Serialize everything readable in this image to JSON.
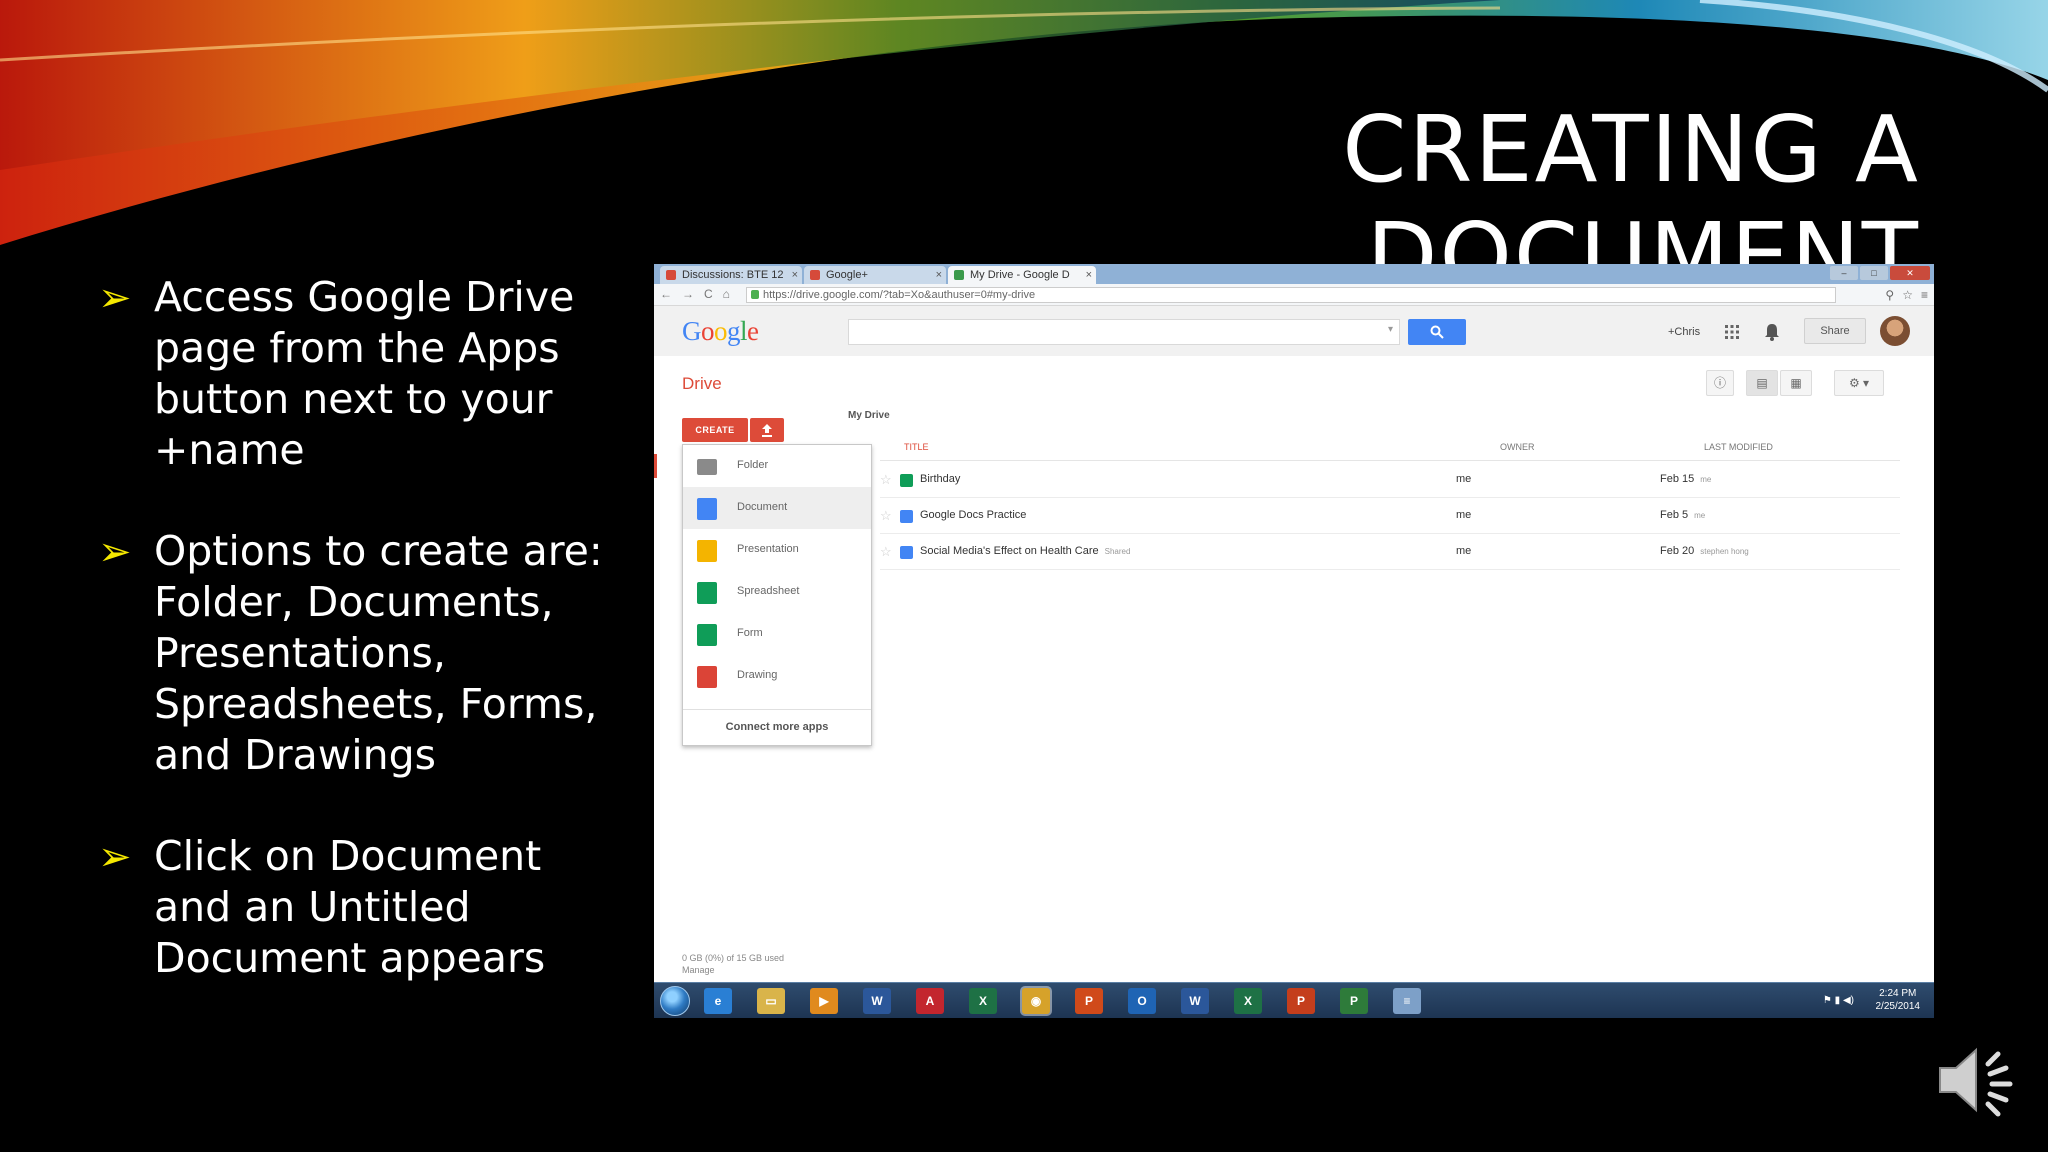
{
  "slide": {
    "title": "CREATING A DOCUMENT",
    "bullets": [
      "Access Google Drive\npage from the Apps\nbutton next to your\n+name",
      "Options to create are:\nFolder, Documents,\nPresentations,\nSpreadsheets, Forms,\nand Drawings",
      "Click on Document\nand an Untitled\nDocument appears"
    ],
    "bullet_symbol": "➢",
    "bullet_color": "#f5e800"
  },
  "browser": {
    "tabs": [
      {
        "label": "Discussions: BTE 12",
        "icon_color": "#d64a3a"
      },
      {
        "label": "Google+",
        "icon_color": "#d64a3a"
      },
      {
        "label": "My Drive - Google D",
        "icon_color": "#3a9a4b"
      }
    ],
    "url": "https://drive.google.com/?tab=Xo&authuser=0#my-drive",
    "window_buttons": [
      "–",
      "□",
      "✕"
    ]
  },
  "google": {
    "logo": [
      "G",
      "o",
      "o",
      "g",
      "l",
      "e"
    ],
    "logo_colors": [
      "#4285f4",
      "#ea4335",
      "#fbbc05",
      "#4285f4",
      "#34a853",
      "#ea4335"
    ],
    "user": "+Chris",
    "share_label": "Share"
  },
  "drive": {
    "title": "Drive",
    "create_label": "CREATE",
    "breadcrumb": "My Drive",
    "create_menu": [
      {
        "label": "Folder",
        "color": "#8a8a8a"
      },
      {
        "label": "Document",
        "color": "#4285f4"
      },
      {
        "label": "Presentation",
        "color": "#f4b400"
      },
      {
        "label": "Spreadsheet",
        "color": "#0f9d58"
      },
      {
        "label": "Form",
        "color": "#0f9d58"
      },
      {
        "label": "Drawing",
        "color": "#db4437"
      }
    ],
    "connect_more": "Connect more apps",
    "columns": {
      "title": "TITLE",
      "owner": "OWNER",
      "modified": "LAST MODIFIED"
    },
    "files": [
      {
        "name": "Birthday",
        "tag": "",
        "owner": "me",
        "modified": "Feb 15",
        "by": "me",
        "icon_color": "#0f9d58"
      },
      {
        "name": "Google Docs Practice",
        "tag": "",
        "owner": "me",
        "modified": "Feb 5",
        "by": "me",
        "icon_color": "#4285f4"
      },
      {
        "name": "Social Media's Effect on Health Care",
        "tag": "Shared",
        "owner": "me",
        "modified": "Feb 20",
        "by": "stephen hong",
        "icon_color": "#4285f4"
      }
    ],
    "storage": "0 GB (0%) of 15 GB used",
    "manage": "Manage"
  },
  "taskbar": {
    "apps": [
      {
        "name": "ie-icon",
        "glyph": "e",
        "color": "#2a7fd4"
      },
      {
        "name": "explorer-icon",
        "glyph": "▭",
        "color": "#d9b44a"
      },
      {
        "name": "media-player-icon",
        "glyph": "▶",
        "color": "#e08a1e"
      },
      {
        "name": "word-icon",
        "glyph": "W",
        "color": "#2b579a"
      },
      {
        "name": "acrobat-icon",
        "glyph": "A",
        "color": "#c3262e"
      },
      {
        "name": "excel-icon",
        "glyph": "X",
        "color": "#1e7145"
      },
      {
        "name": "chrome-icon",
        "glyph": "◉",
        "color": "#d6a22a"
      },
      {
        "name": "publisher-icon",
        "glyph": "P",
        "color": "#d04a1a"
      },
      {
        "name": "outlook-icon",
        "glyph": "O",
        "color": "#1f64b4"
      },
      {
        "name": "word2-icon",
        "glyph": "W",
        "color": "#2b579a"
      },
      {
        "name": "excel2-icon",
        "glyph": "X",
        "color": "#1e7145"
      },
      {
        "name": "powerpoint-icon",
        "glyph": "P",
        "color": "#c43e1c"
      },
      {
        "name": "project-icon",
        "glyph": "P",
        "color": "#2e7b3a"
      },
      {
        "name": "notepad-icon",
        "glyph": "≡",
        "color": "#7da0c8"
      }
    ],
    "time": "2:24 PM",
    "date": "2/25/2014"
  }
}
